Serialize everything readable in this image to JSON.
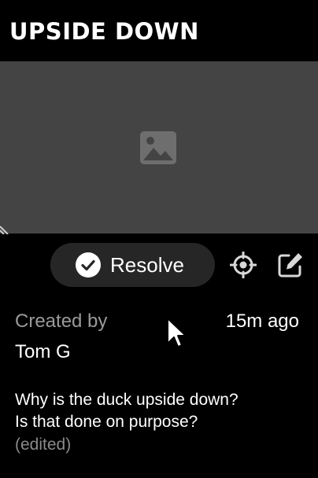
{
  "header": {
    "title": "UPSIDE DOWN"
  },
  "image": {
    "icon": "image-placeholder-icon"
  },
  "toolbar": {
    "resolve_label": "Resolve",
    "resolve_icon": "check-circle-icon",
    "locate_icon": "crosshair-icon",
    "edit_icon": "edit-icon"
  },
  "comment": {
    "created_by_label": "Created by",
    "author": "Tom G",
    "timestamp": "15m ago",
    "body_lines": [
      "Why is the duck upside down?",
      "Is that done on purpose?"
    ],
    "edited_label": "(edited)"
  },
  "colors": {
    "background": "#000000",
    "image_placeholder_bg": "#444444",
    "button_bg": "#262626",
    "muted_text": "#9a9a9a",
    "text": "#ffffff"
  }
}
